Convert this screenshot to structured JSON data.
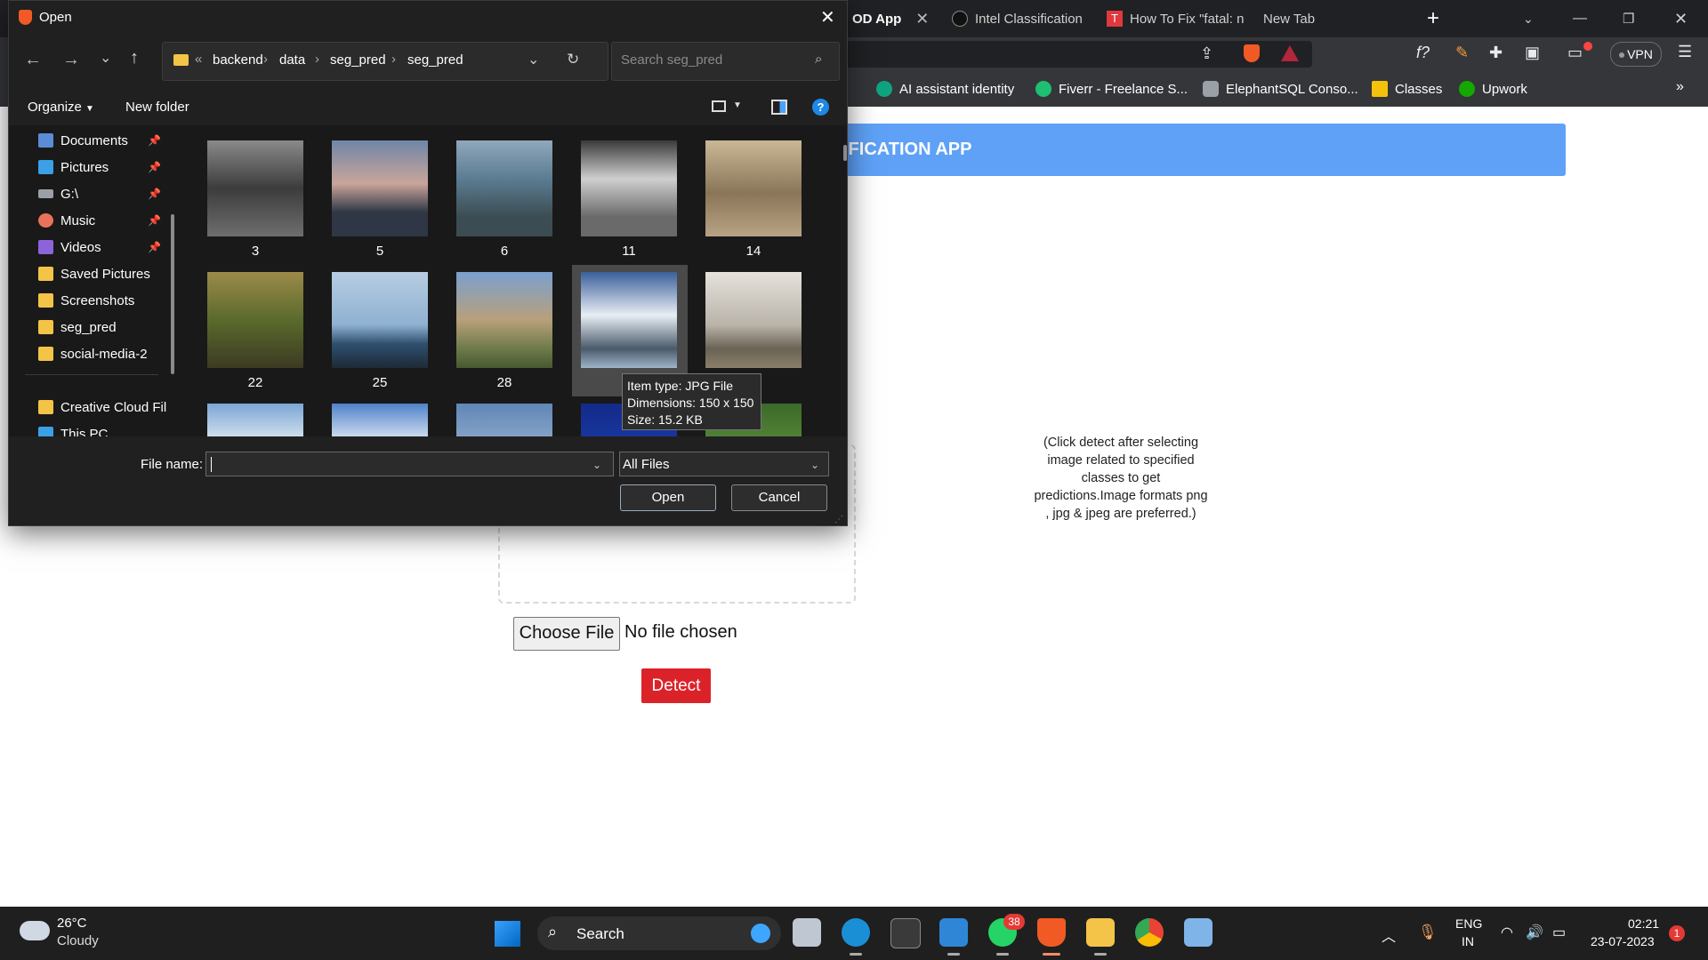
{
  "browser": {
    "tabs": [
      {
        "label": "OD App"
      },
      {
        "label": "Intel Classification"
      },
      {
        "label": "How To Fix \"fatal: n"
      },
      {
        "label": "New Tab"
      }
    ],
    "new_tab": "+",
    "vpn": "VPN",
    "bookmarks": [
      {
        "label": "AI assistant identity",
        "color": "#10a37f"
      },
      {
        "label": "Fiverr - Freelance S...",
        "color": "#1dbf73"
      },
      {
        "label": "ElephantSQL Conso...",
        "color": "#9aa0a6"
      },
      {
        "label": "Classes",
        "color": "#f4c20d"
      },
      {
        "label": "Upwork",
        "color": "#14a800"
      }
    ]
  },
  "page": {
    "banner_title": "IFICATION APP",
    "hint": "(Click detect after selecting image related to specified classes to get predictions.Image formats png , jpg & jpeg are preferred.)",
    "choose_file": "Choose File",
    "no_file": "No file chosen",
    "detect": "Detect"
  },
  "dialog": {
    "title": "Open",
    "breadcrumb": [
      "backend",
      "data",
      "seg_pred",
      "seg_pred"
    ],
    "search_placeholder": "Search seg_pred",
    "organize": "Organize",
    "new_folder": "New folder",
    "nav_items": [
      {
        "label": "Documents",
        "icon": "documents-icon",
        "pinned": true
      },
      {
        "label": "Pictures",
        "icon": "pictures-icon",
        "pinned": true
      },
      {
        "label": "G:\\",
        "icon": "drive-icon",
        "pinned": true
      },
      {
        "label": "Music",
        "icon": "music-icon",
        "pinned": true
      },
      {
        "label": "Videos",
        "icon": "videos-icon",
        "pinned": true
      },
      {
        "label": "Saved Pictures",
        "icon": "folder-icon",
        "pinned": false
      },
      {
        "label": "Screenshots",
        "icon": "folder-icon",
        "pinned": false
      },
      {
        "label": "seg_pred",
        "icon": "folder-icon",
        "pinned": false
      },
      {
        "label": "social-media-2",
        "icon": "folder-icon",
        "pinned": false
      },
      {
        "label": "Creative Cloud Fil",
        "icon": "creative-cloud-icon",
        "pinned": false
      },
      {
        "label": "This PC",
        "icon": "this-pc-icon",
        "pinned": false
      }
    ],
    "files": [
      {
        "label": "3"
      },
      {
        "label": "5"
      },
      {
        "label": "6"
      },
      {
        "label": "11"
      },
      {
        "label": "14"
      },
      {
        "label": "22"
      },
      {
        "label": "25"
      },
      {
        "label": "28"
      },
      {
        "label": "",
        "selected": true
      },
      {
        "label": "38"
      },
      {
        "label": ""
      },
      {
        "label": ""
      },
      {
        "label": ""
      },
      {
        "label": ""
      },
      {
        "label": ""
      }
    ],
    "tooltip": {
      "type": "Item type: JPG File",
      "dimensions": "Dimensions: 150 x 150",
      "size": "Size: 15.2 KB"
    },
    "file_name_label": "File name:",
    "file_name_value": "",
    "file_type": "All Files",
    "open": "Open",
    "cancel": "Cancel"
  },
  "taskbar": {
    "temperature": "26°C",
    "weather": "Cloudy",
    "search": "Search",
    "whatsapp_badge": "38",
    "lang_top": "ENG",
    "lang_bottom": "IN",
    "time": "02:21",
    "date": "23-07-2023",
    "notifications": "1"
  }
}
